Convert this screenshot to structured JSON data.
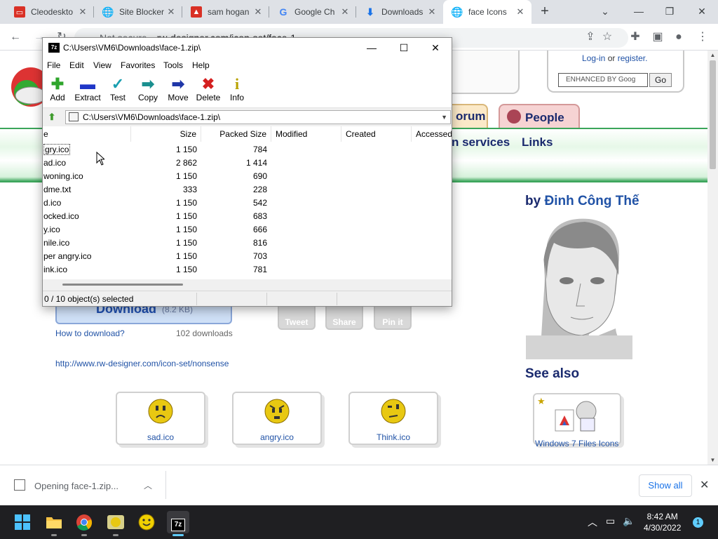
{
  "browser": {
    "tabs": [
      {
        "title": "Cleodeskto",
        "favicon": "cleodesk-icon",
        "color": "#d93025"
      },
      {
        "title": "Site Blocker",
        "favicon": "globe-icon",
        "color": "#5f6368"
      },
      {
        "title": "sam hogan",
        "favicon": "image-icon",
        "color": "#d93025"
      },
      {
        "title": "Google Ch",
        "favicon": "google-icon",
        "color": "#4285f4"
      },
      {
        "title": "Downloads",
        "favicon": "download-icon",
        "color": "#1a73e8"
      },
      {
        "title": "face Icons",
        "favicon": "globe-icon",
        "color": "#5f6368"
      }
    ],
    "address": {
      "security": "Not secure",
      "url": "rw-designer.com/icon-set/face-1"
    }
  },
  "webpage": {
    "login": "Log-in",
    "or": "or",
    "register": "register.",
    "search_placeholder": "ENHANCED BY Goog",
    "go": "Go",
    "nav_tabs": [
      "orum",
      "People"
    ],
    "nav_links": [
      "n services",
      "Links"
    ],
    "author_prefix": "by",
    "author_name": "Đinh Công Thế",
    "download_label": "Download",
    "download_size": "(8.2 KB)",
    "how_to_download": "How to download?",
    "download_count": "102 downloads",
    "social": [
      "Tweet",
      "Share",
      "Pin it"
    ],
    "set_url": "http://www.rw-designer.com/icon-set/nonsense",
    "see_also": "See also",
    "icons": [
      {
        "label": "sad.ico"
      },
      {
        "label": "angry.ico"
      },
      {
        "label": "Think.ico"
      }
    ],
    "related_set": "Windows 7 Files Icons"
  },
  "zip": {
    "title": "C:\\Users\\VM6\\Downloads\\face-1.zip\\",
    "app_icon": "7z",
    "menu": [
      "File",
      "Edit",
      "View",
      "Favorites",
      "Tools",
      "Help"
    ],
    "tools": [
      {
        "label": "Add",
        "icon": "plus-icon",
        "color": "#2ea52b"
      },
      {
        "label": "Extract",
        "icon": "minus-icon",
        "color": "#1f36c7"
      },
      {
        "label": "Test",
        "icon": "check-icon",
        "color": "#1a9fb0"
      },
      {
        "label": "Copy",
        "icon": "copy-arrow-icon",
        "color": "#1a8f8f"
      },
      {
        "label": "Move",
        "icon": "move-arrow-icon",
        "color": "#1f36a8"
      },
      {
        "label": "Delete",
        "icon": "delete-icon",
        "color": "#d42020"
      },
      {
        "label": "Info",
        "icon": "info-icon",
        "color": "#b8a200"
      }
    ],
    "path": "C:\\Users\\VM6\\Downloads\\face-1.zip\\",
    "columns": [
      "e",
      "Size",
      "Packed Size",
      "Modified",
      "Created",
      "Accessed"
    ],
    "rows": [
      {
        "name": "gry.ico",
        "size": "1 150",
        "packed": "784"
      },
      {
        "name": "ad.ico",
        "size": "2 862",
        "packed": "1 414"
      },
      {
        "name": "woning.ico",
        "size": "1 150",
        "packed": "690"
      },
      {
        "name": "dme.txt",
        "size": "333",
        "packed": "228"
      },
      {
        "name": "d.ico",
        "size": "1 150",
        "packed": "542"
      },
      {
        "name": "ocked.ico",
        "size": "1 150",
        "packed": "683"
      },
      {
        "name": "y.ico",
        "size": "1 150",
        "packed": "666"
      },
      {
        "name": "nile.ico",
        "size": "1 150",
        "packed": "816"
      },
      {
        "name": "per angry.ico",
        "size": "1 150",
        "packed": "703"
      },
      {
        "name": "ink.ico",
        "size": "1 150",
        "packed": "781"
      }
    ],
    "status": "0 / 10 object(s) selected"
  },
  "shelf": {
    "file": "Opening face-1.zip...",
    "show_all": "Show all"
  },
  "taskbar": {
    "time": "8:42 AM",
    "date": "4/30/2022",
    "notifications": "1",
    "accent": "#60cdff"
  }
}
